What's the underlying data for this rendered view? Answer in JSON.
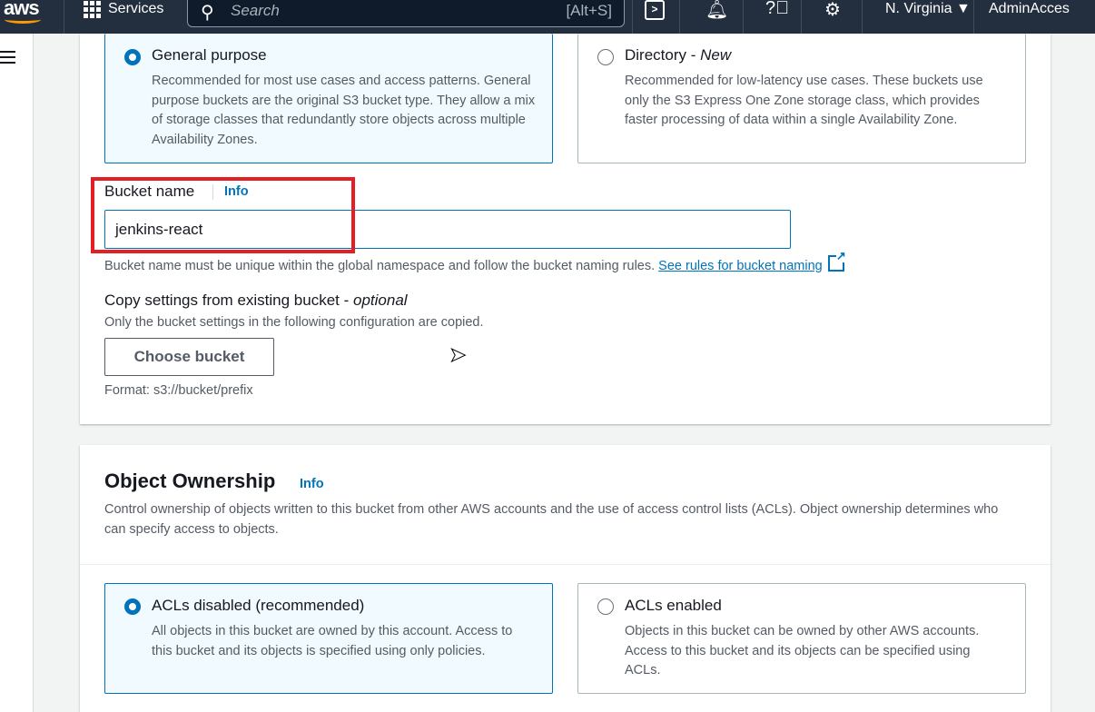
{
  "topnav": {
    "logo": "aws",
    "services": "Services",
    "search_placeholder": "Search",
    "search_shortcut": "[Alt+S]",
    "region": "N. Virginia ▼",
    "account": "AdminAcces"
  },
  "bucket_type": {
    "general": {
      "title": "General purpose",
      "desc": "Recommended for most use cases and access patterns. General purpose buckets are the original S3 bucket type. They allow a mix of storage classes that redundantly store objects across multiple Availability Zones."
    },
    "directory": {
      "title": "Directory - ",
      "title_suffix": "New",
      "desc": "Recommended for low-latency use cases. These buckets use only the S3 Express One Zone storage class, which provides faster processing of data within a single Availability Zone."
    }
  },
  "bucket_name": {
    "label": "Bucket name",
    "info": "Info",
    "value": "jenkins-react",
    "hint": "Bucket name must be unique within the global namespace and follow the bucket naming rules.",
    "rules_link": "See rules for bucket naming"
  },
  "copy_settings": {
    "label": "Copy settings from existing bucket - ",
    "label_suffix": "optional",
    "desc": "Only the bucket settings in the following configuration are copied.",
    "button": "Choose bucket",
    "format": "Format: s3://bucket/prefix"
  },
  "ownership": {
    "title": "Object Ownership",
    "info": "Info",
    "desc": "Control ownership of objects written to this bucket from other AWS accounts and the use of access control lists (ACLs). Object ownership determines who can specify access to objects.",
    "disabled": {
      "title": "ACLs disabled (recommended)",
      "desc": "All objects in this bucket are owned by this account. Access to this bucket and its objects is specified using only policies."
    },
    "enabled": {
      "title": "ACLs enabled",
      "desc": "Objects in this bucket can be owned by other AWS accounts. Access to this bucket and its objects can be specified using ACLs."
    }
  }
}
